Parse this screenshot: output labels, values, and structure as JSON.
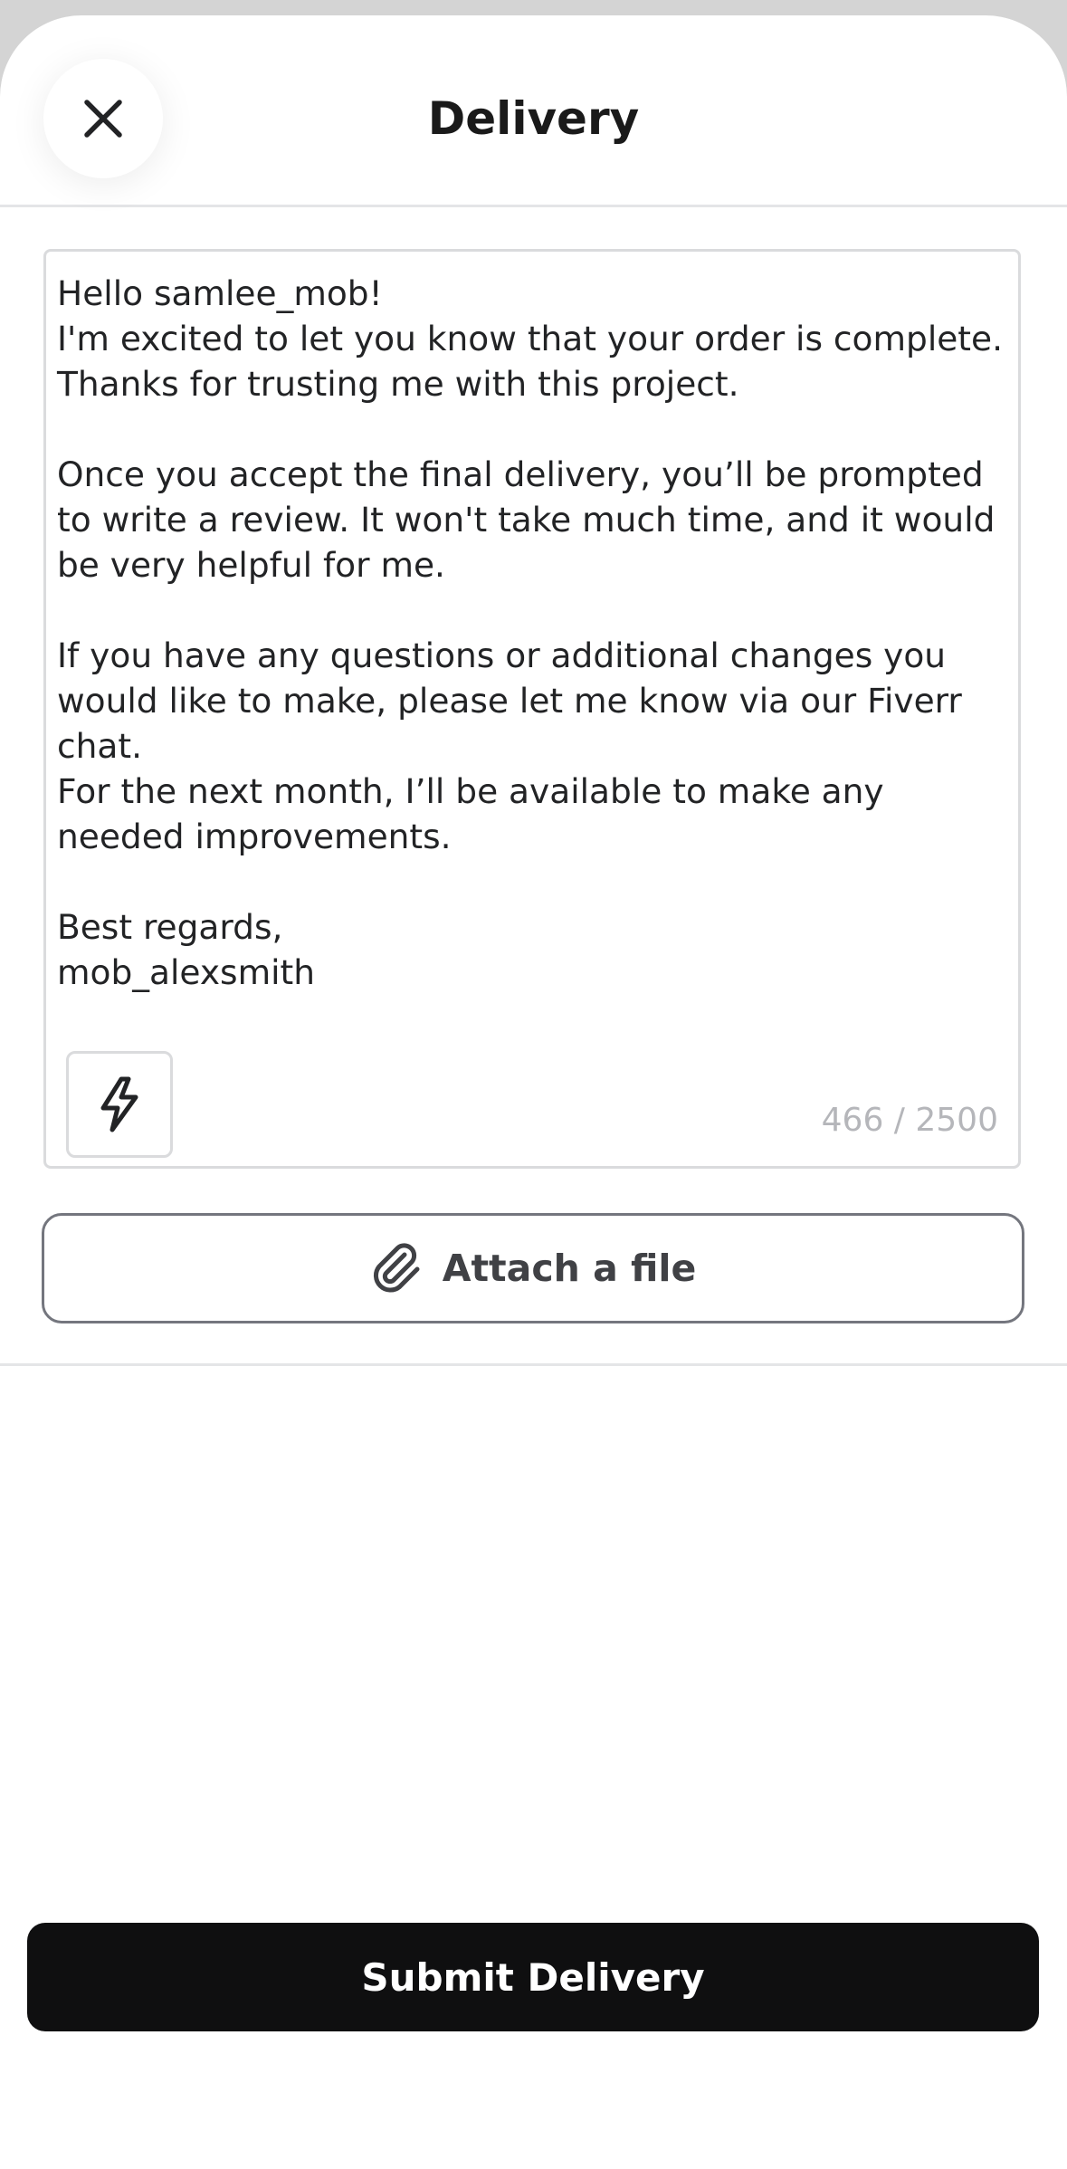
{
  "header": {
    "title": "Delivery",
    "close_icon": "close-icon"
  },
  "message": {
    "text": "Hello samlee_mob!\nI'm excited to let you know that your order is complete. Thanks for trusting me with this project.\n\nOnce you accept the final delivery, you’ll be prompted to write a review. It won't take much time, and it would be very helpful for me.\n\nIf you have any questions or additional changes you would like to make, please let me know via our Fiverr chat.\nFor the next month, I’ll be available to make any needed improvements.\n\nBest regards,\nmob_alexsmith",
    "char_count": "466 / 2500",
    "quick_response_icon": "lightning-icon"
  },
  "attach": {
    "label": "Attach a file",
    "icon": "paperclip-icon"
  },
  "submit": {
    "label": "Submit Delivery"
  },
  "colors": {
    "submit_bg": "#0f0f10",
    "text": "#222325",
    "muted": "#b5b6ba",
    "border": "#dadbdd"
  }
}
